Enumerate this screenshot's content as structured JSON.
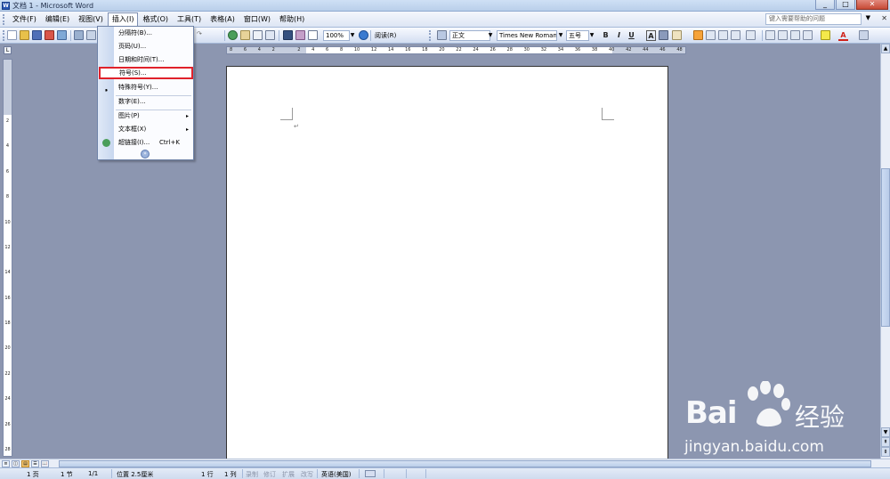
{
  "window": {
    "title": "文档 1 - Microsoft Word",
    "btn_min": "_",
    "btn_max": "□",
    "btn_close": "✕"
  },
  "menubar": {
    "items": [
      "文件(F)",
      "编辑(E)",
      "视图(V)",
      "插入(I)",
      "格式(O)",
      "工具(T)",
      "表格(A)",
      "窗口(W)",
      "帮助(H)"
    ],
    "help_placeholder": "键入需要帮助的问题",
    "help_arrow": "▼",
    "close_doc": "✕"
  },
  "toolbar": {
    "zoom": "100%",
    "read_button": "阅读(R)",
    "style": "正文",
    "font": "Times New Roman",
    "size": "五号",
    "bold": "B",
    "italic": "I",
    "underline": "U",
    "char_border": "A",
    "font_color": "A"
  },
  "ruler": {
    "corner": "L",
    "h_ticks": [
      "8",
      "6",
      "4",
      "2",
      "",
      "2",
      "4",
      "6",
      "8",
      "10",
      "12",
      "14",
      "16",
      "18",
      "20",
      "22",
      "24",
      "26",
      "28",
      "30",
      "32",
      "34",
      "36",
      "38",
      "40",
      "42",
      "44",
      "46",
      "48"
    ],
    "v_ticks": [
      "2",
      "4",
      "6",
      "8",
      "10",
      "12",
      "14",
      "16",
      "18",
      "20",
      "22",
      "24",
      "26",
      "28"
    ]
  },
  "document": {
    "para_mark": "↵"
  },
  "insert_menu": {
    "items": [
      {
        "label": "分隔符(B)..."
      },
      {
        "label": "页码(U)..."
      },
      {
        "label": "日期和时间(T)..."
      },
      {
        "label": "符号(S)..."
      },
      {
        "label": "特殊符号(Y)..."
      },
      {
        "label": "数字(E)..."
      },
      {
        "label": "图片(P)"
      },
      {
        "label": "文本框(X)"
      },
      {
        "label": "超链接(I)...",
        "shortcut": "Ctrl+K"
      }
    ],
    "submenu_arrow": "▸",
    "expand": "»"
  },
  "statusbar": {
    "page": "1 页",
    "section": "1 节",
    "page_of": "1/1",
    "position": "位置 2.5厘米",
    "line": "1 行",
    "col": "1 列",
    "rec": "录制",
    "trk": "修订",
    "ext": "扩展",
    "ovr": "改写",
    "lang": "英语(美国)"
  },
  "watermark": {
    "brand": "Bai",
    "brand2": "经验",
    "url": "jingyan.baidu.com"
  }
}
